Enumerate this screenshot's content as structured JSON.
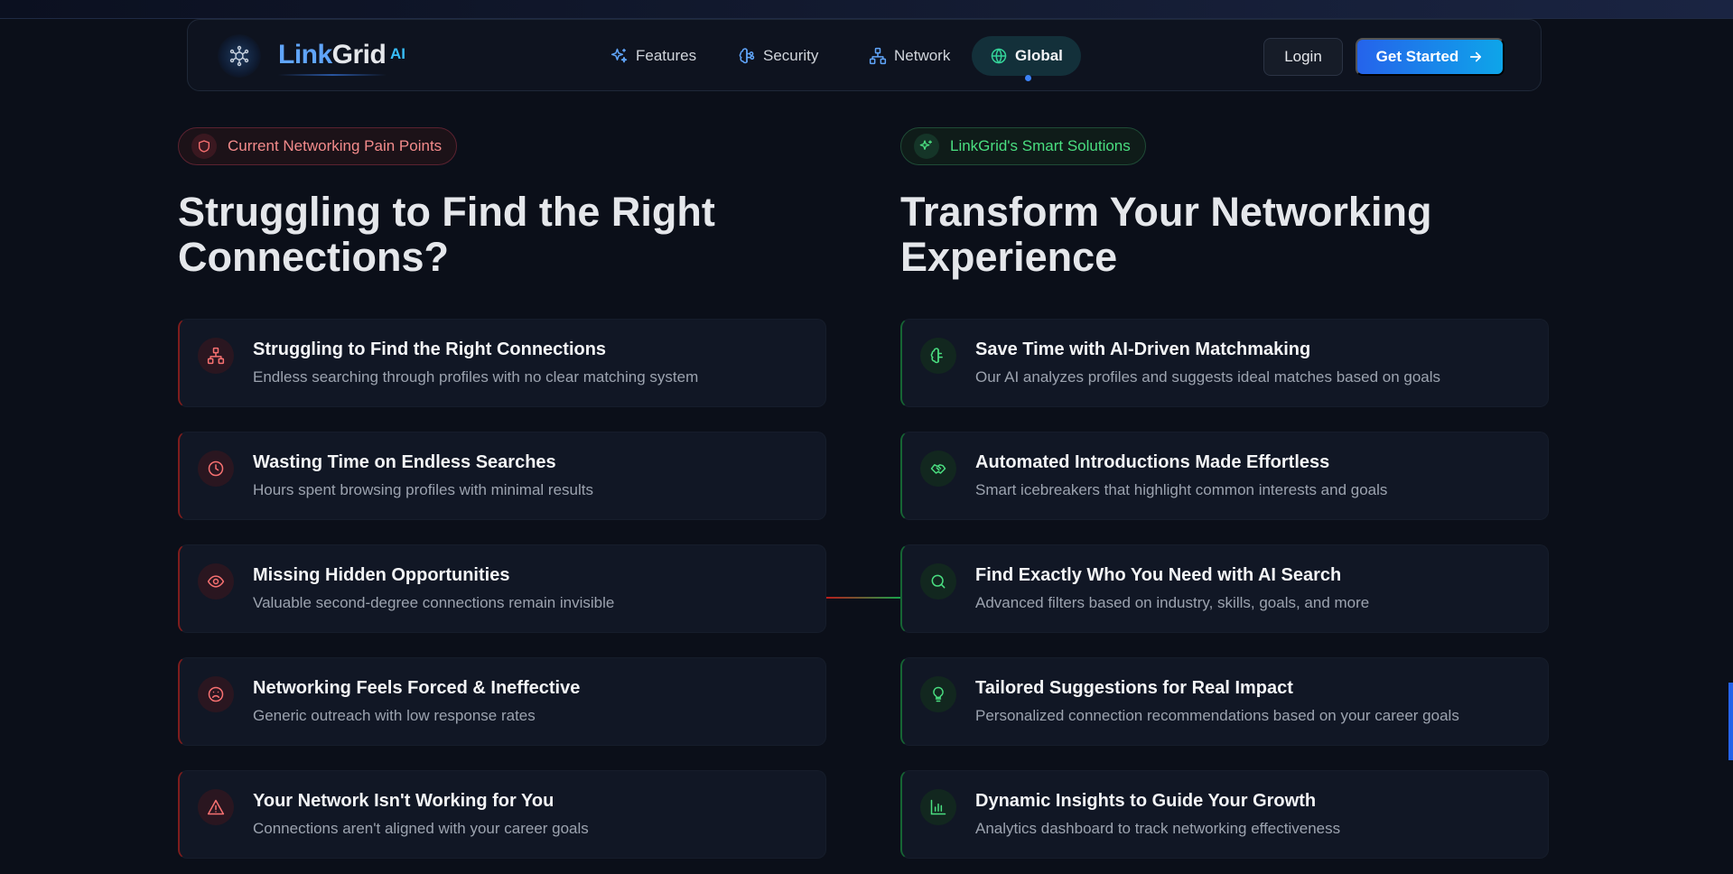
{
  "nav": {
    "logo_link": "Link",
    "logo_grid": "Grid",
    "logo_ai": "AI",
    "items": [
      {
        "label": "Features",
        "icon": "sparkles-icon"
      },
      {
        "label": "Security",
        "icon": "brain-icon"
      },
      {
        "label": "Network",
        "icon": "network-icon"
      },
      {
        "label": "Global",
        "icon": "globe-icon",
        "active": true
      }
    ],
    "login": "Login",
    "get_started": "Get Started"
  },
  "pain": {
    "badge": "Current Networking Pain Points",
    "heading": "Struggling to Find the Right Connections?",
    "cards": [
      {
        "title": "Struggling to Find the Right Connections",
        "desc": "Endless searching through profiles with no clear matching system",
        "icon": "network-icon"
      },
      {
        "title": "Wasting Time on Endless Searches",
        "desc": "Hours spent browsing profiles with minimal results",
        "icon": "clock-icon"
      },
      {
        "title": "Missing Hidden Opportunities",
        "desc": "Valuable second-degree connections remain invisible",
        "icon": "eye-icon"
      },
      {
        "title": "Networking Feels Forced & Ineffective",
        "desc": "Generic outreach with low response rates",
        "icon": "frown-icon"
      },
      {
        "title": "Your Network Isn't Working for You",
        "desc": "Connections aren't aligned with your career goals",
        "icon": "warning-icon"
      }
    ]
  },
  "solutions": {
    "badge": "LinkGrid's Smart Solutions",
    "heading": "Transform Your Networking Experience",
    "cards": [
      {
        "title": "Save Time with AI-Driven Matchmaking",
        "desc": "Our AI analyzes profiles and suggests ideal matches based on goals",
        "icon": "brain-icon"
      },
      {
        "title": "Automated Introductions Made Effortless",
        "desc": "Smart icebreakers that highlight common interests and goals",
        "icon": "handshake-icon"
      },
      {
        "title": "Find Exactly Who You Need with AI Search",
        "desc": "Advanced filters based on industry, skills, goals, and more",
        "icon": "search-icon"
      },
      {
        "title": "Tailored Suggestions for Real Impact",
        "desc": "Personalized connection recommendations based on your career goals",
        "icon": "lightbulb-icon"
      },
      {
        "title": "Dynamic Insights to Guide Your Growth",
        "desc": "Analytics dashboard to track networking effectiveness",
        "icon": "chart-icon"
      }
    ]
  },
  "colors": {
    "pain_accent": "#f87171",
    "solution_accent": "#4ade80",
    "primary": "#2563eb"
  }
}
